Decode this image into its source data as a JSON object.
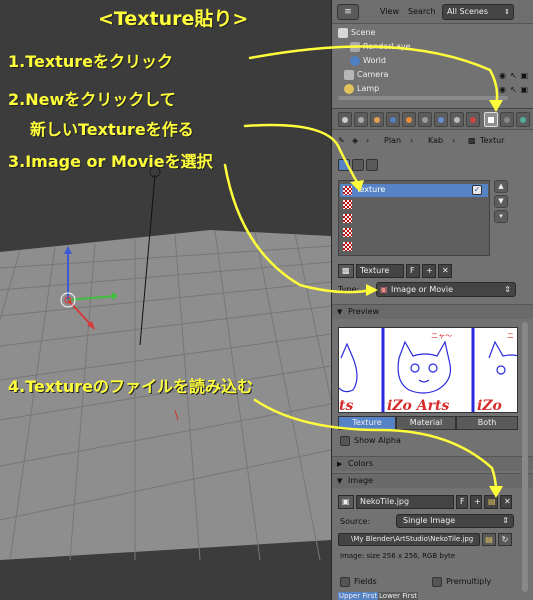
{
  "colors": {
    "annotation": "#ffff3c",
    "selection": "#5683c6",
    "panel_bg": "#727272",
    "viewport_bg": "#3c3c3c"
  },
  "outliner": {
    "editor_icon": "outliner-icon",
    "menu_view": "View",
    "menu_search": "Search",
    "scenes": "All Scenes",
    "rows": [
      {
        "label": "Scene",
        "icon": "scene-icon"
      },
      {
        "label": "RenderLaye",
        "icon": "render-layer-icon"
      },
      {
        "label": "World",
        "icon": "world-icon"
      },
      {
        "label": "Camera",
        "icon": "camera-icon"
      },
      {
        "label": "Lamp",
        "icon": "lamp-icon"
      }
    ]
  },
  "breadcrumb": {
    "items": [
      "Plan",
      "Kab",
      "Textur"
    ]
  },
  "texture_panel": {
    "slots": [
      "Texture",
      "",
      "",
      "",
      ""
    ],
    "id_name": "Texture",
    "id_fake": "F",
    "type_label": "Type:",
    "type_value": "Image or Movie",
    "preview_title": "Preview",
    "preview_tabs": [
      "Texture",
      "Material",
      "Both"
    ],
    "show_alpha": "Show Alpha",
    "colors_title": "Colors",
    "image_title": "Image",
    "image_name": "NekoTile.jpg",
    "image_fake": "F",
    "source_label": "Source:",
    "source_value": "Single Image",
    "file_path": "\\My Blender\\ArtStudio\\NekoTile.jpg",
    "image_info": "Image: size 256 x 256, RGB byte",
    "fields": "Fields",
    "premultiply": "Premultiply",
    "upper_first": "Upper First",
    "lower_first": "Lower First"
  },
  "annotations": {
    "title": "<Texture貼り>",
    "step1": "1.Textureをクリック",
    "step2a": "2.Newをクリックして",
    "step2b": "新しいTextureを作る",
    "step3": "3.Image or Movieを選択",
    "step4": "4.Textureのファイルを読み込む"
  }
}
